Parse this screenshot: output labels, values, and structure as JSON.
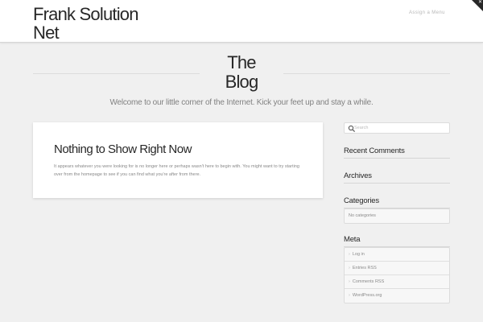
{
  "header": {
    "site_title_line1": "Frank Solution",
    "site_title_line2": "Net",
    "menu_link": "Assign a Menu",
    "corner_glyph": "✕"
  },
  "landmark": {
    "title_line1": "The",
    "title_line2": "Blog",
    "tagline": "Welcome to our little corner of the Internet. Kick your feet up and stay a while."
  },
  "post": {
    "title": "Nothing to Show Right Now",
    "text": "It appears whatever you were looking for is no longer here or perhaps wasn't here to begin with. You might want to try starting over from the homepage to see if you can find what you're after from there."
  },
  "sidebar": {
    "search_placeholder": "Search",
    "recent_comments_title": "Recent Comments",
    "archives_title": "Archives",
    "categories_title": "Categories",
    "no_categories": "No categories",
    "meta_title": "Meta",
    "meta_links": [
      "Log in",
      "Entries RSS",
      "Comments RSS",
      "WordPress.org"
    ],
    "chevron_glyph": "›"
  },
  "colors": {
    "background": "#f0f0f0",
    "header_bg": "#ffffff",
    "text_dark": "#272727",
    "text_muted": "#828282"
  }
}
